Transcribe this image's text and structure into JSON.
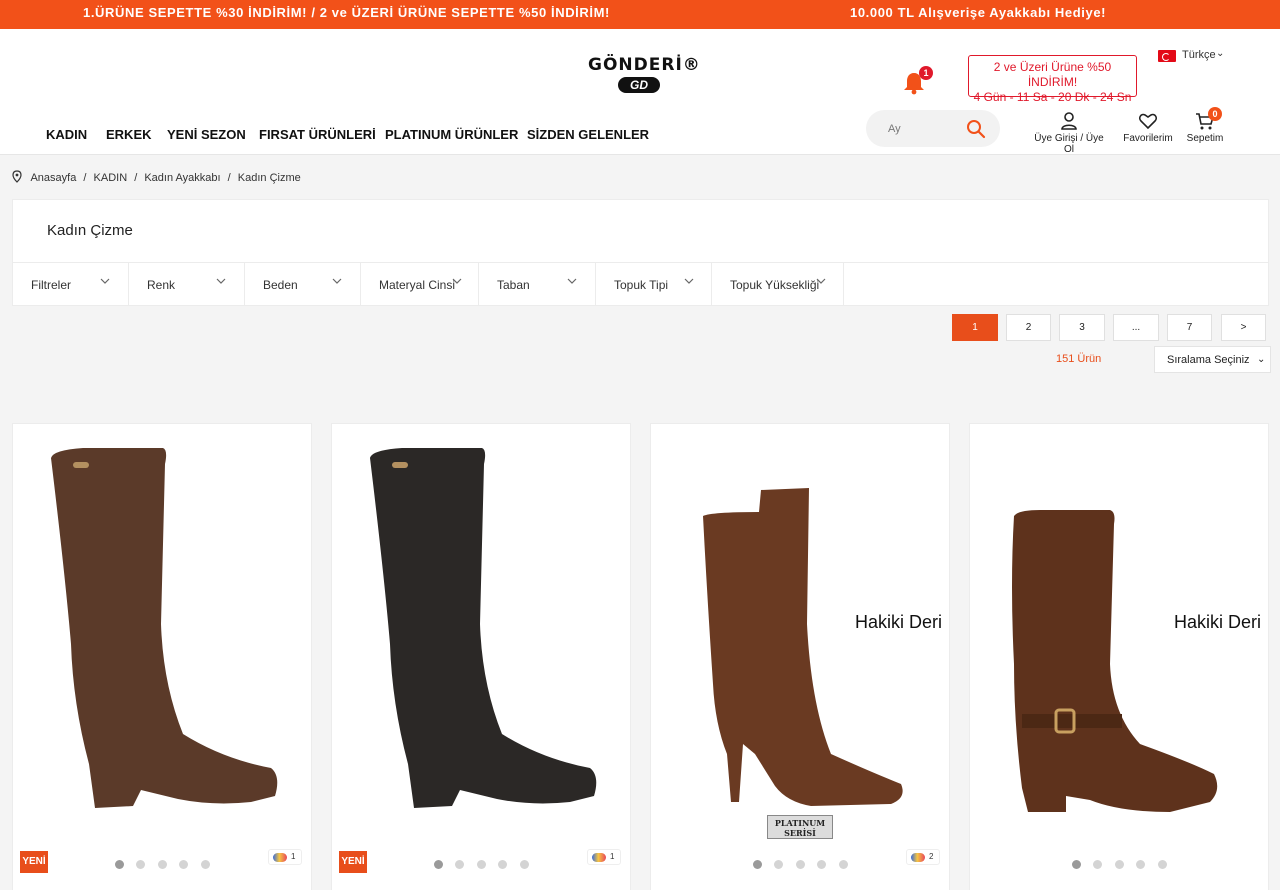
{
  "topbar": {
    "message_left": "1.ÜRÜNE SEPETTE %30 İNDİRİM! / 2 ve ÜZERİ ÜRÜNE SEPETTE %50 İNDİRİM!",
    "message_right": "10.000 TL Alışverişe Ayakkabı Hediye!"
  },
  "brand": {
    "wordmark": "GÖNDERİ®",
    "monogram": "GD"
  },
  "notifications": {
    "count": "1"
  },
  "promo": {
    "line1": "2 ve Üzeri Ürüne %50 İNDİRİM!",
    "line2": "4 Gün - 11 Sa - 20 Dk - 24 Sn"
  },
  "language": {
    "label": "Türkçe",
    "chevron": "⌄"
  },
  "nav": {
    "items": [
      "KADIN",
      "ERKEK",
      "YENİ SEZON",
      "FIRSAT ÜRÜNLERİ",
      "PLATINUM ÜRÜNLER",
      "SİZDEN GELENLER"
    ]
  },
  "search": {
    "placeholder": "Ay"
  },
  "account": {
    "login_label": "Üye Girişi / Üye Ol",
    "favorites_label": "Favorilerim",
    "cart_label": "Sepetim",
    "cart_count": "0"
  },
  "breadcrumb": [
    "Anasayfa",
    "/",
    "KADIN",
    "/",
    "Kadın Ayakkabı",
    "/",
    "Kadın Çizme"
  ],
  "category": {
    "title": "Kadın Çizme"
  },
  "filters": [
    "Filtreler",
    "Renk",
    "Beden",
    "Materyal Cinsi",
    "Taban",
    "Topuk Tipi",
    "Topuk Yüksekliği"
  ],
  "pagination": {
    "pages": [
      "1",
      "2",
      "3",
      "...",
      "7",
      ">"
    ],
    "active": "1"
  },
  "results": {
    "count_label": "151 Ürün",
    "sort_label": "Sıralama Seçiniz",
    "sort_chevron": "⌄"
  },
  "products": [
    {
      "badge": "YENİ",
      "color_count": "1",
      "overlay_text": "",
      "series_badge": "",
      "boot_color": "#5b3a29",
      "active_dot": 0,
      "dot_count": 5
    },
    {
      "badge": "YENİ",
      "color_count": "1",
      "overlay_text": "",
      "series_badge": "",
      "boot_color": "#2b2826",
      "active_dot": 0,
      "dot_count": 5
    },
    {
      "badge": "",
      "color_count": "2",
      "overlay_text": "Hakiki Deri",
      "series_badge": "PLATINUM SERİSİ",
      "boot_color": "#6a3a22",
      "active_dot": 0,
      "dot_count": 5
    },
    {
      "badge": "",
      "color_count": "",
      "overlay_text": "Hakiki Deri",
      "series_badge": "",
      "boot_color": "#5e321c",
      "active_dot": 0,
      "dot_count": 5
    }
  ]
}
